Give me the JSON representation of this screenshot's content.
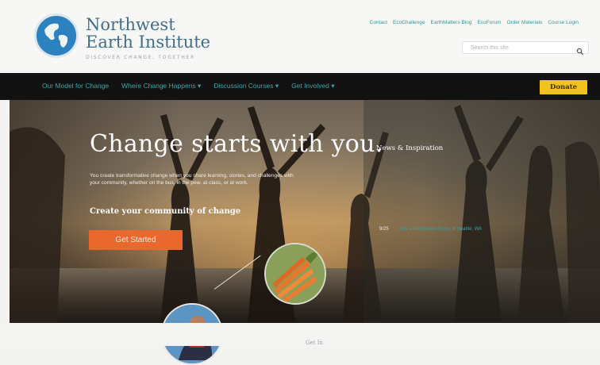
{
  "brand": {
    "name_line1": "Northwest",
    "name_line2": "Earth Institute",
    "tagline": "DISCOVER CHANGE, TOGETHER",
    "colors": {
      "blue": "#2b82bf",
      "teal_link": "#3aa5a6",
      "donate_yellow": "#f1c21c",
      "cta_orange": "#e8682e"
    }
  },
  "utility_nav": {
    "items": [
      "Contact",
      "EcoChallenge",
      "EarthMatters Blog",
      "EcoForum",
      "Order Materials",
      "Course Login"
    ]
  },
  "search": {
    "placeholder": "Search this site",
    "icon": "search-icon"
  },
  "main_nav": {
    "items": [
      "Our Model for Change",
      "Where Change Happens",
      "Discussion Courses",
      "Get Involved"
    ],
    "dropdown_flags": [
      false,
      true,
      true,
      true
    ],
    "donate_label": "Donate"
  },
  "hero": {
    "title": "Change starts with you.",
    "body": "You create transformative change when you share learning, stories, and challenges with your community, whether on the bus, in the pew, at class, or at work.",
    "subhead": "Create your community of change",
    "cta_label": "Get Started"
  },
  "news": {
    "title": "News & Inspiration",
    "items": [
      {
        "date": "9/25",
        "text": "Join a Discussion Group in Seattle, WA"
      }
    ]
  },
  "footer": {
    "text": "Get In"
  }
}
